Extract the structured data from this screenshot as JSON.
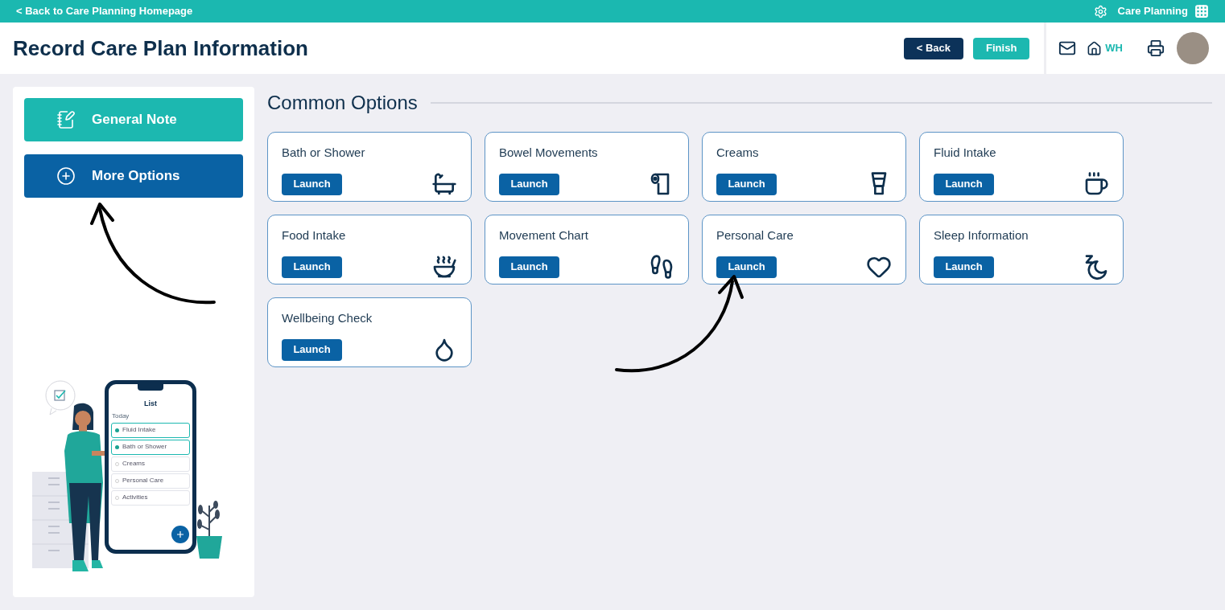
{
  "top_bar": {
    "back_link": "< Back to Care Planning Homepage",
    "app_name": "Care Planning"
  },
  "header": {
    "title": "Record Care Plan Information",
    "back_button": "< Back",
    "finish_button": "Finish",
    "home_label": "WH"
  },
  "sidebar": {
    "buttons": [
      {
        "label": "General Note",
        "kind": "note"
      },
      {
        "label": "More Options",
        "kind": "more"
      }
    ],
    "illustration": {
      "phone_title": "List",
      "phone_subtitle": "Today",
      "items": [
        {
          "label": "Fluid Intake",
          "checked": true
        },
        {
          "label": "Bath or Shower",
          "checked": true
        },
        {
          "label": "Creams",
          "checked": false
        },
        {
          "label": "Personal Care",
          "checked": false
        },
        {
          "label": "Activities",
          "checked": false
        }
      ]
    }
  },
  "section": {
    "title": "Common Options",
    "cards": [
      {
        "title": "Bath or Shower",
        "button": "Launch"
      },
      {
        "title": "Bowel Movements",
        "button": "Launch"
      },
      {
        "title": "Creams",
        "button": "Launch"
      },
      {
        "title": "Fluid Intake",
        "button": "Launch"
      },
      {
        "title": "Food Intake",
        "button": "Launch"
      },
      {
        "title": "Movement Chart",
        "button": "Launch"
      },
      {
        "title": "Personal Care",
        "button": "Launch"
      },
      {
        "title": "Sleep Information",
        "button": "Launch"
      },
      {
        "title": "Wellbeing Check",
        "button": "Launch"
      }
    ]
  }
}
